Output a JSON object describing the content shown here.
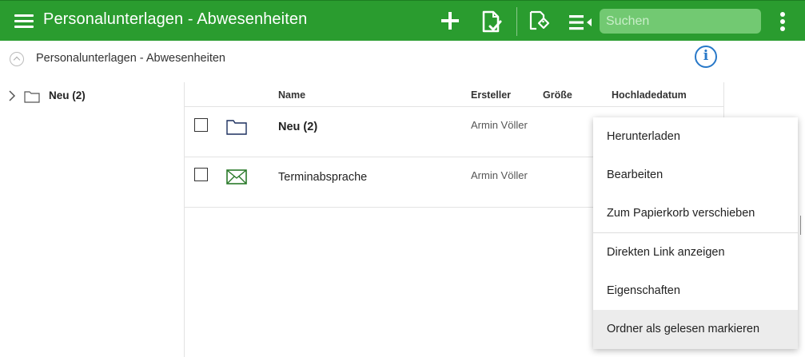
{
  "header": {
    "title": "Personalunterlagen - Abwesenheiten",
    "icons": [
      "menu-icon",
      "plus-icon",
      "document-check-icon",
      "tag-edit-icon",
      "list-sort-icon",
      "kebab-menu-icon"
    ],
    "search": {
      "placeholder": "Suchen",
      "value": ""
    },
    "brand_color": "#2a9c2f",
    "search_bg": "#72c972"
  },
  "breadcrumb": {
    "text": "Personalunterlagen - Abwesenheiten",
    "icons": [
      "collapse-up-icon",
      "info-icon"
    ]
  },
  "tree": {
    "items": [
      {
        "label": "Neu (2)",
        "icon": "folder-icon",
        "expander": "chevron-right-icon"
      }
    ]
  },
  "table": {
    "columns": [
      "Name",
      "Ersteller",
      "Größe",
      "Hochladedatum"
    ],
    "rows": [
      {
        "name": "Neu  (2)",
        "creator": "Armin Völler",
        "size": "",
        "date": "",
        "icon": "folder-icon",
        "bold": true
      },
      {
        "name": "Terminabsprache",
        "creator": "Armin Völler",
        "size": "",
        "date": "",
        "icon": "envelope-icon",
        "bold": false
      }
    ]
  },
  "context_menu": {
    "items": [
      {
        "label": "Herunterladen"
      },
      {
        "label": "Bearbeiten"
      },
      {
        "label": "Zum Papierkorb verschieben"
      },
      {
        "label": "Direkten Link anzeigen"
      },
      {
        "label": "Eigenschaften"
      },
      {
        "label": "Ordner als gelesen markieren",
        "highlighted": true
      }
    ]
  },
  "colors": {
    "info_blue": "#2878c8",
    "folder_navy": "#1b2f5e",
    "envelope_green": "#2a7a2a"
  }
}
